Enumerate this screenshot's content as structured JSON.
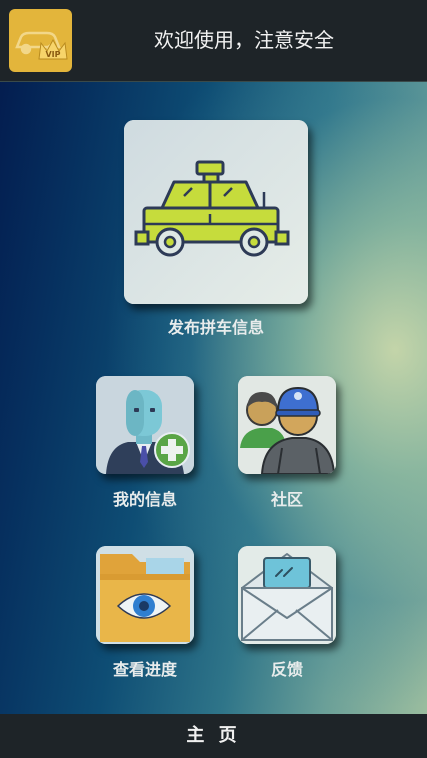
{
  "header": {
    "title": "欢迎使用，注意安全",
    "logo_icon": "vip-car-icon",
    "logo_badge": "VIP"
  },
  "main": {
    "publish": {
      "label": "发布拼车信息",
      "icon": "taxi-icon"
    },
    "my_info": {
      "label": "我的信息",
      "icon": "add-user-icon"
    },
    "community": {
      "label": "社区",
      "icon": "community-icon"
    },
    "progress": {
      "label": "查看进度",
      "icon": "folder-eye-icon"
    },
    "feedback": {
      "label": "反馈",
      "icon": "mail-message-icon"
    }
  },
  "bottom_nav": {
    "home_label": "主 页"
  },
  "colors": {
    "header_bg": "#1e2428",
    "accent_yellow": "#e3b53b",
    "taxi_green": "#c6dc3c"
  }
}
